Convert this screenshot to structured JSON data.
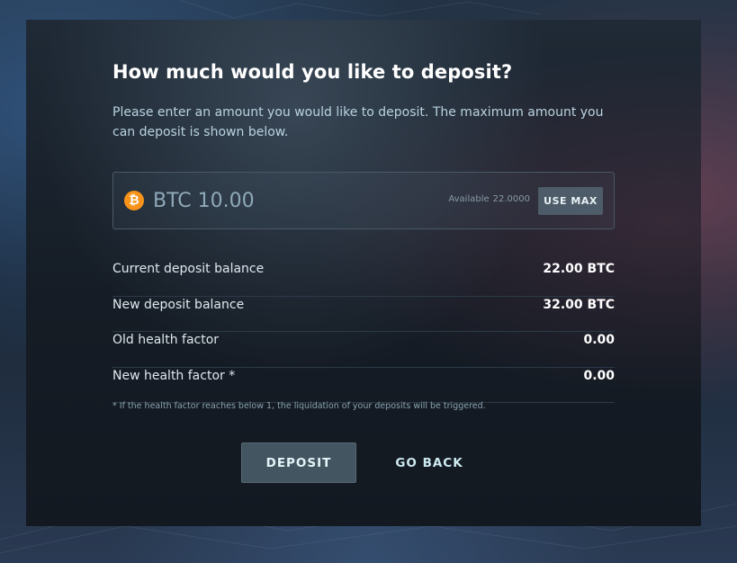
{
  "dialog": {
    "title": "How much would you like to deposit?",
    "subtitle": "Please enter an amount you would like to deposit. The maximum amount you can deposit is shown below."
  },
  "amount": {
    "coin_icon": "bitcoin-icon",
    "coin_symbol": "₿",
    "value": "BTC 10.00",
    "available_label": "Available",
    "available_value": "22.0000",
    "use_max_label": "USE MAX"
  },
  "summary": [
    {
      "label": "Current deposit balance",
      "value": "22.00 BTC"
    },
    {
      "label": "New deposit balance",
      "value": "32.00 BTC"
    },
    {
      "label": "Old health factor",
      "value": "0.00"
    },
    {
      "label": "New health factor *",
      "value": "0.00"
    }
  ],
  "footnote": "* If the health factor reaches below 1, the liquidation of your deposits will be triggered.",
  "actions": {
    "deposit_label": "DEPOSIT",
    "back_label": "GO BACK"
  },
  "colors": {
    "accent_coin": "#f7931a",
    "button_bg": "#435560"
  }
}
